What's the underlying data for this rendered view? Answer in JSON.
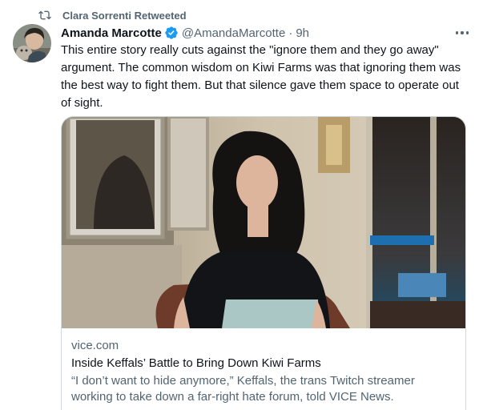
{
  "retweet": {
    "icon": "retweet-icon",
    "label": "Clara Sorrenti Retweeted"
  },
  "tweet": {
    "author_name": "Amanda Marcotte",
    "verified_icon": "verified-badge-icon",
    "handle": "@AmandaMarcotte",
    "separator": "·",
    "time": "9h",
    "text": "This entire story really cuts against the \"ignore them and they go away\" argument. The common wisdom on Kiwi Farms was that ignoring them was the best way to fight them. But that silence gave them space to operate out of sight.",
    "more_icon": "more-options-icon"
  },
  "card": {
    "domain": "vice.com",
    "title": "Inside Keffals’ Battle to Bring Down Kiwi Farms",
    "description": "“I don’t want to hide anymore,” Keffals, the trans Twitch streamer working to take down a far-right hate forum, told VICE News."
  },
  "colors": {
    "text_primary": "#0f1419",
    "text_secondary": "#536471",
    "verified_blue": "#1d9bf0",
    "border": "#cfd9de"
  }
}
